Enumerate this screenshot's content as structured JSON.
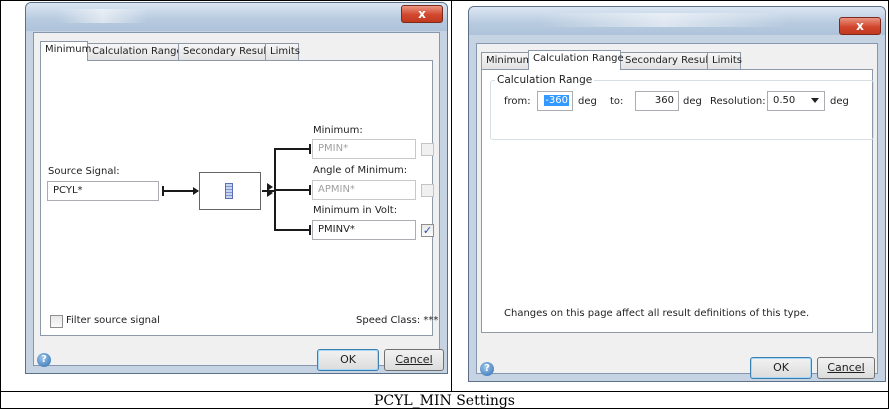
{
  "caption": "PCYL_MIN Settings",
  "close_label": "x",
  "left_dialog": {
    "tabs": [
      {
        "label": "Minimum",
        "active": true
      },
      {
        "label": "Calculation Range",
        "active": false
      },
      {
        "label": "Secondary Results",
        "active": false
      },
      {
        "label": "Limits",
        "active": false
      }
    ],
    "source_signal": {
      "label": "Source Signal:",
      "value": "PCYL*"
    },
    "outputs": [
      {
        "label": "Minimum:",
        "value": "PMIN*",
        "checked": false
      },
      {
        "label": "Angle of Minimum:",
        "value": "APMIN*",
        "checked": false
      },
      {
        "label": "Minimum in Volt:",
        "value": "PMINV*",
        "checked": true
      }
    ],
    "filter_label": "Filter source signal",
    "speed_class": "Speed Class: ***",
    "ok_label": "OK",
    "cancel_label": "Cancel",
    "help_icon": "question-icon"
  },
  "right_dialog": {
    "tabs": [
      {
        "label": "Minimum",
        "active": false
      },
      {
        "label": "Calculation Range",
        "active": true
      },
      {
        "label": "Secondary Results",
        "active": false
      },
      {
        "label": "Limits",
        "active": false
      }
    ],
    "group_title": "Calculation Range",
    "from_label": "from:",
    "from_value": "-360",
    "to_label": "to:",
    "to_value": "360",
    "unit": "deg",
    "resolution_label": "Resolution:",
    "resolution_value": "0.50",
    "note": "Changes on this page affect all result definitions of this type.",
    "ok_label": "OK",
    "cancel_label": "Cancel",
    "help_icon": "question-icon"
  }
}
